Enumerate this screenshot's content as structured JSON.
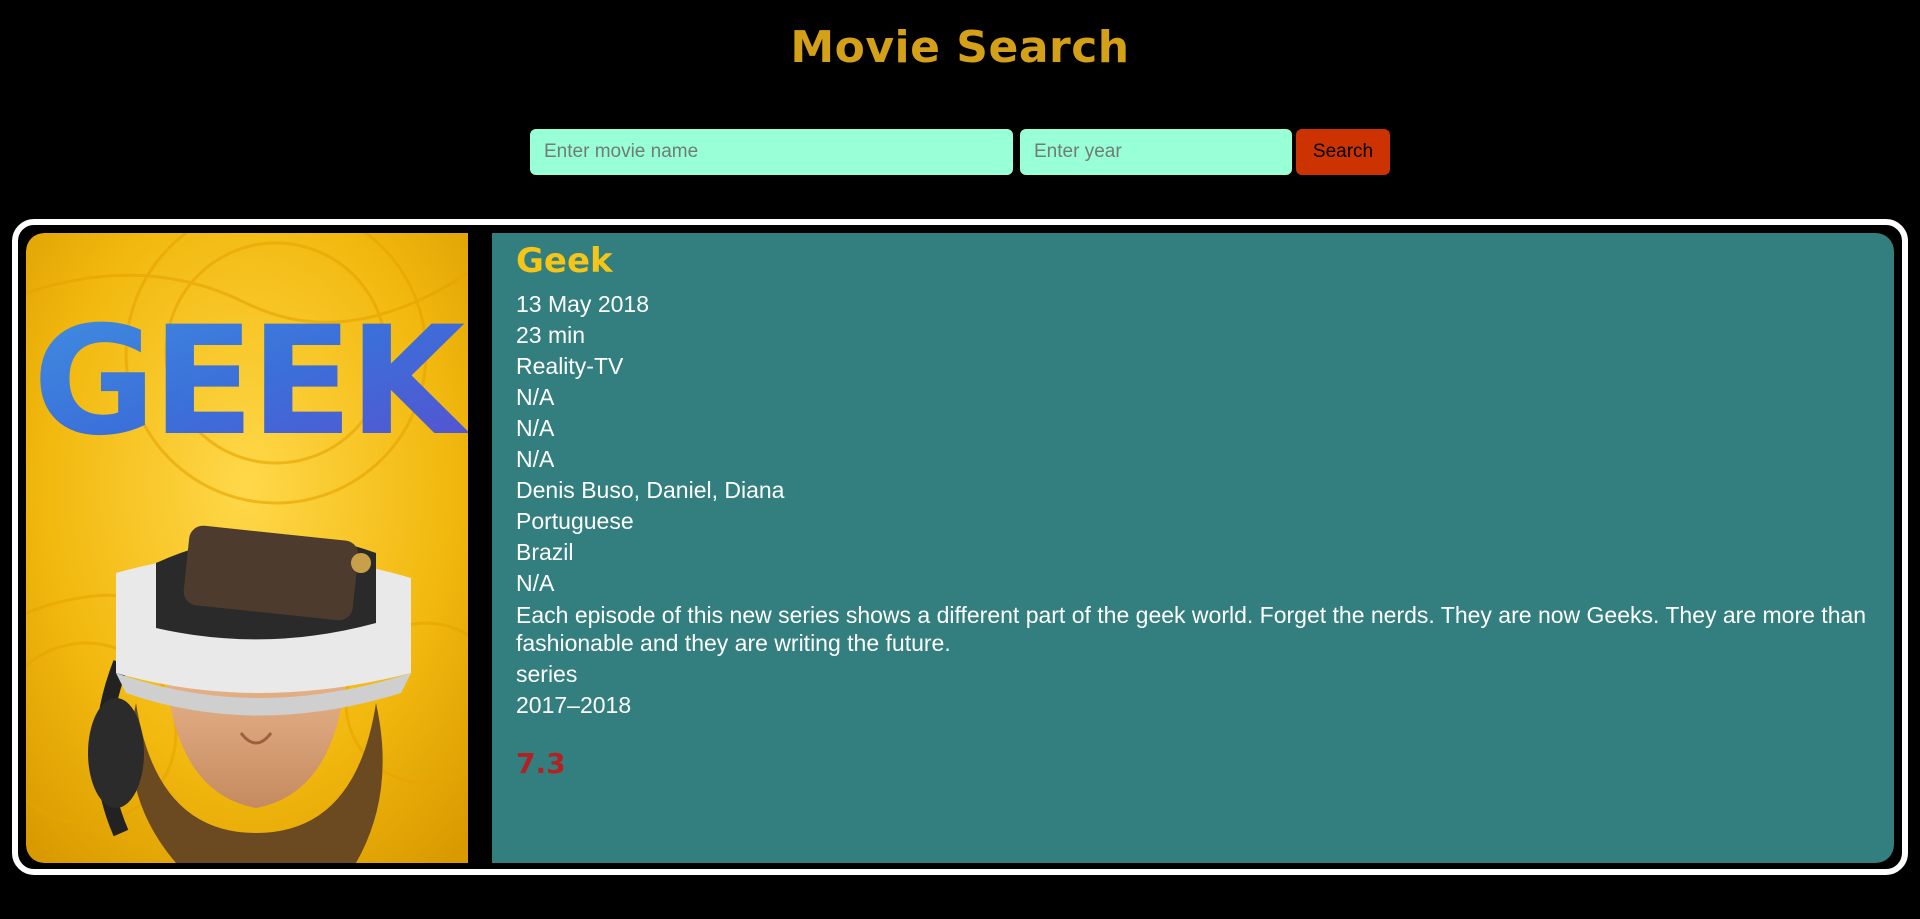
{
  "header": {
    "title": "Movie Search"
  },
  "search": {
    "movie_placeholder": "Enter movie name",
    "movie_value": "",
    "year_placeholder": "Enter year",
    "year_value": "",
    "button_label": "Search"
  },
  "movie": {
    "poster_text": "GEEK",
    "title": "Geek",
    "released": "13 May 2018",
    "runtime": "23 min",
    "genre": "Reality-TV",
    "director": "N/A",
    "writer": "N/A",
    "rated": "N/A",
    "actors": "Denis Buso, Daniel, Diana",
    "language": "Portuguese",
    "country": "Brazil",
    "awards": "N/A",
    "plot": "Each episode of this new series shows a different part of the geek world. Forget the nerds. They are now Geeks. They are more than fashionable and they are writing the future.",
    "type": "series",
    "year": "2017–2018",
    "rating": "7.3"
  },
  "colors": {
    "background": "#000000",
    "title": "#d4a017",
    "input_bg": "#99ffd6",
    "button_bg": "#cc3300",
    "details_bg": "#337f7f",
    "movie_title": "#f5c518",
    "rating": "#b22222"
  }
}
